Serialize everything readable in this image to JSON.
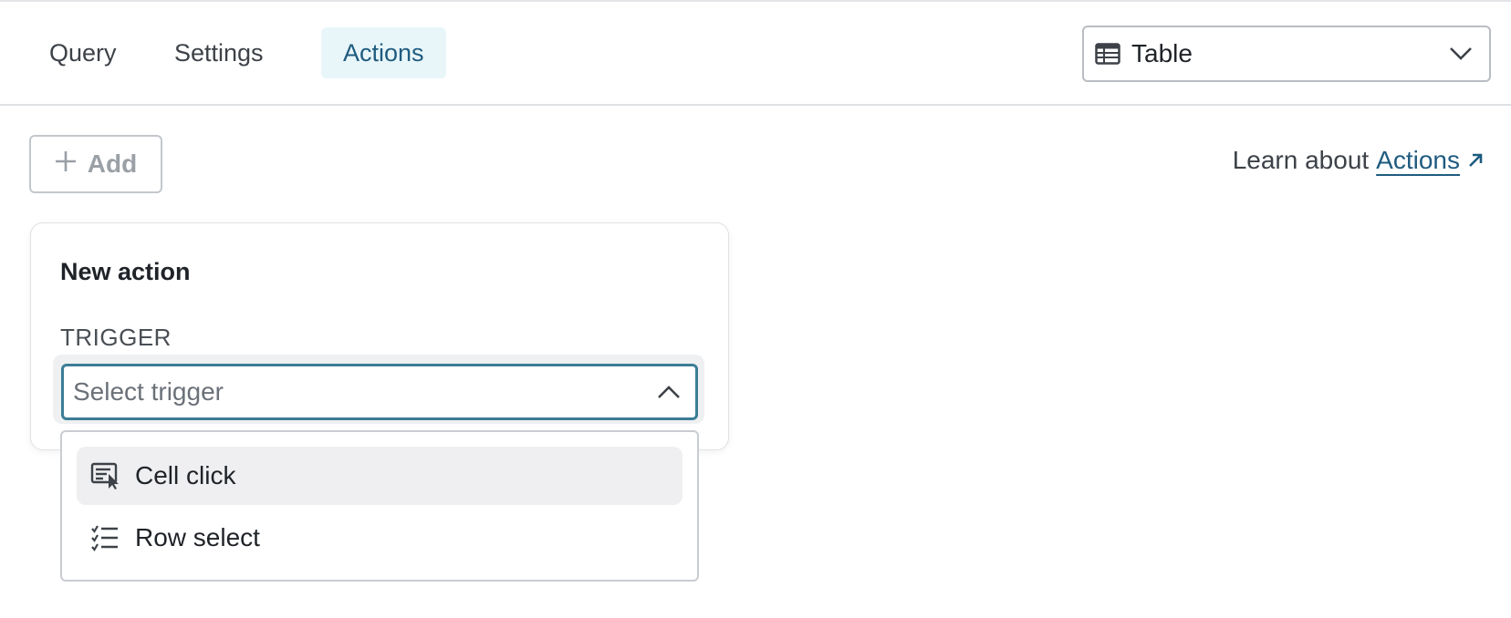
{
  "tabs": [
    {
      "label": "Query",
      "active": false
    },
    {
      "label": "Settings",
      "active": false
    },
    {
      "label": "Actions",
      "active": true
    }
  ],
  "visualization_select": {
    "value": "Table",
    "icon": "table-icon"
  },
  "toolbar": {
    "add_label": "Add",
    "learn_prefix": "Learn about",
    "learn_link": "Actions"
  },
  "card": {
    "title": "New action",
    "trigger_label": "TRIGGER",
    "trigger_placeholder": "Select trigger"
  },
  "trigger_options": [
    {
      "label": "Cell click",
      "icon": "cell-click-icon"
    },
    {
      "label": "Row select",
      "icon": "row-select-icon"
    }
  ],
  "colors": {
    "accent": "#1f5b80",
    "active_tab_bg": "#e8f6f9",
    "focus_border": "#3b7d96",
    "hover_bg": "#efeff1"
  }
}
